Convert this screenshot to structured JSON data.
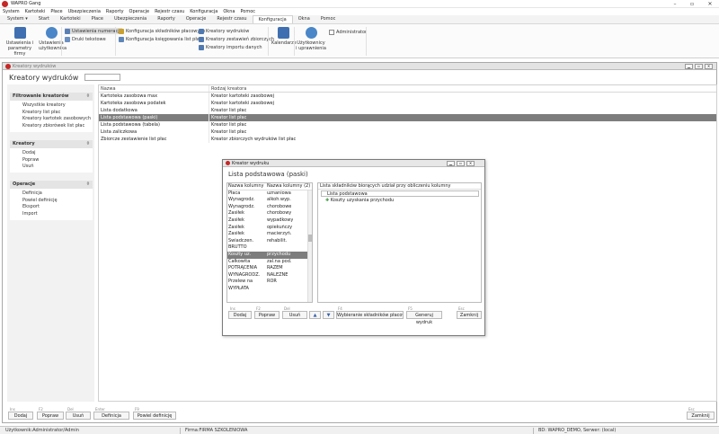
{
  "app": {
    "title": "WAPRO Gang"
  },
  "menu": [
    "System",
    "Kartoteki",
    "Płace",
    "Ubezpieczenia",
    "Raporty",
    "Operacje",
    "Rejestr czasu",
    "Konfiguracja",
    "Okna",
    "Pomoc"
  ],
  "tabs": [
    {
      "label": "System",
      "active": false
    },
    {
      "label": "Start",
      "active": false
    },
    {
      "label": "Kartoteki",
      "active": false
    },
    {
      "label": "Płace",
      "active": false
    },
    {
      "label": "Ubezpieczenia",
      "active": false
    },
    {
      "label": "Raporty",
      "active": false
    },
    {
      "label": "Operacje",
      "active": false
    },
    {
      "label": "Rejestr czasu",
      "active": false
    },
    {
      "label": "Konfiguracja",
      "active": true
    },
    {
      "label": "Okna",
      "active": false
    },
    {
      "label": "Pomoc",
      "active": false
    }
  ],
  "ribbon": {
    "firm_params": "Ustawienia i parametry firmy",
    "user_settings": "Ustawienia użytkownika",
    "numbering": "Ustawienia numeracji",
    "text_printouts": "Druki tekstowe",
    "payroll_components": "Konfiguracja składników płacowych",
    "payroll_booking": "Konfiguracja księgowania list płac",
    "report_creators": "Kreatory wydruków",
    "summary_creators": "Kreatory zestawień zbiorczych",
    "import_creators": "Kreatory importu danych",
    "calendars": "Kalendarze",
    "users_permissions": "Użytkownicy i uprawnienia",
    "administrator": "Administrator",
    "administrator_checked": false
  },
  "window": {
    "title": "Kreatory wydruków",
    "page_title": "Kreatory wydruków"
  },
  "sidebar": {
    "filter": {
      "title": "Filtrowanie kreatorów",
      "items": [
        "Wszystkie kreatory",
        "Kreatory list płac",
        "Kreatory kartotek zasobowych",
        "Kreatory zbiorówek list płac"
      ]
    },
    "creators": {
      "title": "Kreatory",
      "items": [
        "Dodaj",
        "Popraw",
        "Usuń"
      ]
    },
    "operations": {
      "title": "Operacje",
      "items": [
        "Definicja",
        "Powiel definicję",
        "Eksport",
        "Import"
      ]
    }
  },
  "list": {
    "columns": [
      "Nazwa",
      "Rodzaj kreatora"
    ],
    "rows": [
      [
        "Kartoteka zasobowa max",
        "Kreator kartoteki zasobowej"
      ],
      [
        "Kartoteka zasobowa podatek",
        "Kreator kartoteki zasobowej"
      ],
      [
        "Lista dodatkowa",
        "Kreator list płac"
      ],
      [
        "Lista podstawowa (paski)",
        "Kreator list płac"
      ],
      [
        "Lista podstawowa (tabela)",
        "Kreator list płac"
      ],
      [
        "Lista zaliczkowa",
        "Kreator list płac"
      ],
      [
        "Zbiorcze zestawienie list płac",
        "Kreator zbiorczych wydruków list płac"
      ]
    ],
    "selected": 3
  },
  "bottom_buttons": [
    {
      "key": "Ins",
      "label": "Dodaj"
    },
    {
      "key": "F2",
      "label": "Popraw"
    },
    {
      "key": "Del",
      "label": "Usuń"
    },
    {
      "key": "Enter",
      "label": "Definicja"
    },
    {
      "key": "F9",
      "label": "Powiel definicję"
    }
  ],
  "close_button": {
    "key": "Esc",
    "label": "Zamknij"
  },
  "status": {
    "user": "Użytkownik:Administrator/Admin",
    "firm": "Firma:FIRMA SZKOLENIOWA",
    "db": "BD: WAPRO_DEMO, Serwer: (local)"
  },
  "dialog": {
    "title": "Kreator wydruku",
    "header": "Lista podstawowa (paski)",
    "left_columns": [
      "Nazwa kolumny (1)",
      "Nazwa kolumny (2)"
    ],
    "left_rows": [
      [
        "Płaca",
        "uznaniowa"
      ],
      [
        "Wynagrodz.",
        "alkoh.wyp."
      ],
      [
        "Wynagrodz.",
        "chorobowe"
      ],
      [
        "Zasiłek",
        "chorobowy"
      ],
      [
        "Zasiłek",
        "wypadkowy"
      ],
      [
        "Zasiłek",
        "opiekuńczy"
      ],
      [
        "Zasiłek",
        "macierzyń."
      ],
      [
        "Świadczen.",
        "rehabilit."
      ],
      [
        "BRUTTO",
        ""
      ],
      [
        "Koszty uz.",
        "przychodu"
      ],
      [
        "Całkowita",
        "zal.na pod."
      ],
      [
        "POTRĄCENIA",
        "RAZEM"
      ],
      [
        "WYNAGRODZ.",
        "NALEŻNE"
      ],
      [
        "Przelew na",
        "ROR"
      ],
      [
        "WYPŁATA",
        ""
      ]
    ],
    "left_selected": 9,
    "right_header": "Lista składników biorących udział przy obliczeniu kolumny",
    "tree_root": "Lista podstawowa",
    "tree_child": "Koszty uzyskania przychodu",
    "buttons": [
      {
        "key": "Ins",
        "label": "Dodaj"
      },
      {
        "key": "F2",
        "label": "Popraw"
      },
      {
        "key": "Del",
        "label": "Usuń"
      },
      {
        "key": "",
        "label": "▲"
      },
      {
        "key": "",
        "label": "▼"
      },
      {
        "key": "F4",
        "label": "Wybieranie składników płacowych"
      },
      {
        "key": "F5",
        "label": "Generuj wydruk"
      },
      {
        "key": "Esc",
        "label": "Zamknij"
      }
    ]
  },
  "colors": {
    "selection": "#7d7d7d",
    "brand": "#c62828"
  }
}
